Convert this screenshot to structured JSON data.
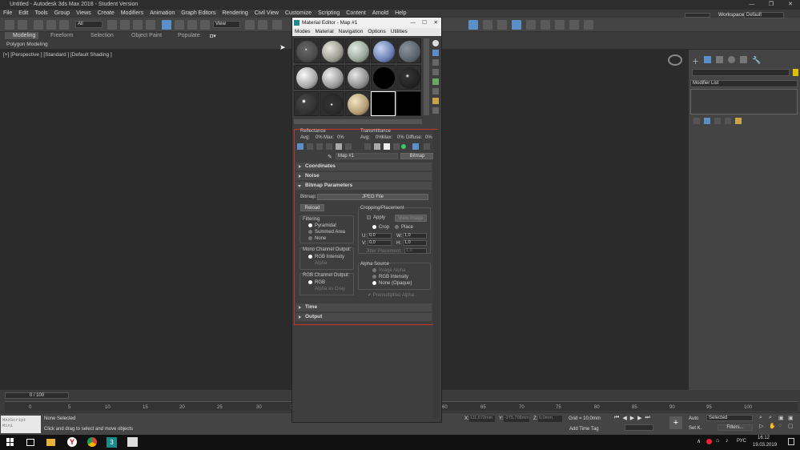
{
  "app": {
    "title": "Untitled - Autodesk 3ds Max 2018 - Student Version"
  },
  "menu": [
    "File",
    "Edit",
    "Tools",
    "Group",
    "Views",
    "Create",
    "Modifiers",
    "Animation",
    "Graph Editors",
    "Rendering",
    "Civil View",
    "Customize",
    "Scripting",
    "Content",
    "Arnold",
    "Help"
  ],
  "toolbar": {
    "selection_filter": "All",
    "ref_coord": "View",
    "workspaces_label": "Workspaces:",
    "workspaces_value": "Default"
  },
  "ribbon": {
    "tabs": [
      "Modeling",
      "Freeform",
      "Selection",
      "Object Paint",
      "Populate"
    ],
    "active_tab": "Modeling",
    "sub": "Polygon Modeling"
  },
  "viewport": {
    "label": "[+] [Perspective ] [Standard ] [Default Shading ]"
  },
  "cmdpanel": {
    "modifier_list": "Modifier List"
  },
  "material_editor": {
    "title": "Material Editor - Map #1",
    "menu": [
      "Modes",
      "Material",
      "Navigation",
      "Options",
      "Utilities"
    ],
    "reflectance": {
      "label": "Reflectance",
      "avg": "Avg:",
      "avg_value": "0%",
      "max": "Max:",
      "max_value": "0%"
    },
    "transmittance": {
      "label": "Transmittance",
      "avg": "Avg:",
      "avg_value": "0%",
      "max": "Max:",
      "max_value": "0%",
      "diffuse": "Diffuse:",
      "diffuse_value": "0%"
    },
    "map_name": "Map #1",
    "map_type": "Bitmap",
    "rollouts": {
      "coordinates": "Coordinates",
      "noise": "Noise",
      "bitmap_params": "Bitmap Parameters",
      "time": "Time",
      "output": "Output"
    },
    "bitmap": {
      "label": "Bitmap:",
      "file": "JPEG File",
      "reload": "Reload",
      "filtering": {
        "title": "Filtering",
        "options": [
          "Pyramidal",
          "Summed Area",
          "None"
        ],
        "selected": "Pyramidal"
      },
      "mono": {
        "title": "Mono Channel Output:",
        "options": [
          "RGB Intensity",
          "Alpha"
        ],
        "selected": "RGB Intensity"
      },
      "rgb": {
        "title": "RGB Channel Output:",
        "options": [
          "RGB",
          "Alpha as Gray"
        ],
        "selected": "RGB"
      },
      "cropping": {
        "title": "Cropping/Placement",
        "apply": "Apply",
        "view_image": "View Image",
        "crop": "Crop",
        "place": "Place",
        "u_label": "U:",
        "u": "0,0",
        "w_label": "W:",
        "w": "1,0",
        "v_label": "V:",
        "v": "0,0",
        "h_label": "H:",
        "h": "1,0",
        "jitter_label": "Jitter Placement:",
        "jitter": "1,0"
      },
      "alpha_source": {
        "title": "Alpha Source",
        "options": [
          "Image Alpha",
          "RGB Intensity",
          "None (Opaque)"
        ],
        "selected": "None (Opaque)",
        "premultiplied": "Premultiplied Alpha"
      }
    }
  },
  "timeline": {
    "frame": "0 / 100",
    "ticks": [
      "0",
      "5",
      "10",
      "15",
      "20",
      "25",
      "30",
      "35",
      "60",
      "65",
      "70",
      "75",
      "80",
      "85",
      "90",
      "95",
      "100"
    ]
  },
  "status": {
    "maxscript": "MAXScript Mini",
    "selected": "None Selected",
    "hint": "Click and drag to select and move objects",
    "x_label": "X:",
    "x": "111,672mm",
    "y_label": "Y:",
    "y": "-275,708mm",
    "z_label": "Z:",
    "z": "0,0mm",
    "grid": "Grid = 10,0mm",
    "add_time_tag": "Add Time Tag",
    "auto": "Auto",
    "selected_dd": "Selected",
    "setk": "Set K.",
    "filters": "Filters..."
  },
  "taskbar": {
    "lang": "РУС",
    "time": "16:12",
    "date": "19.03.2019"
  }
}
